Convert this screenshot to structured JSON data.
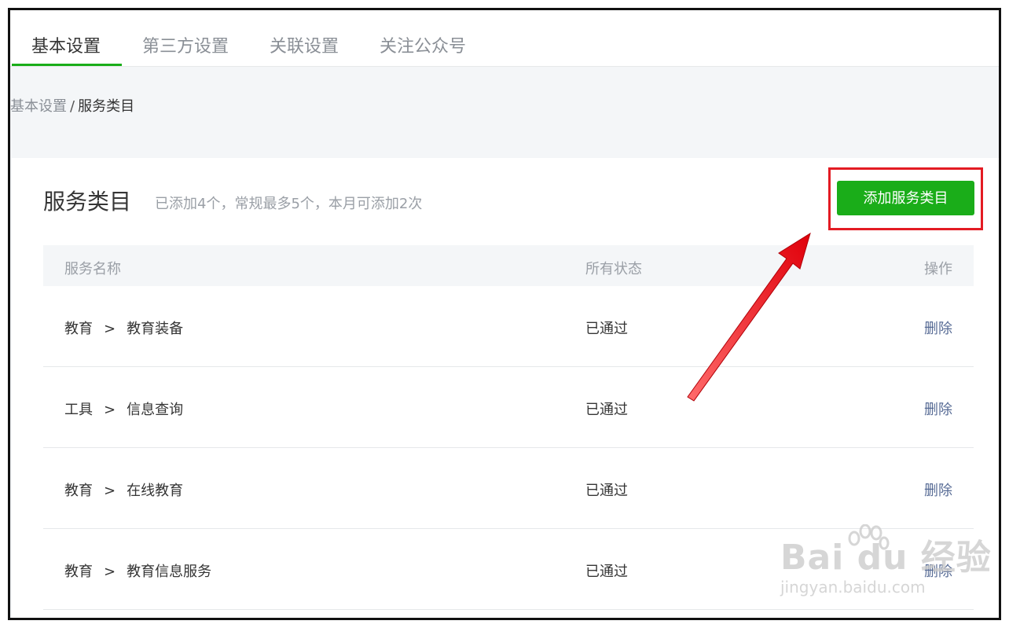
{
  "tabs": [
    {
      "label": "基本设置",
      "active": true
    },
    {
      "label": "第三方设置",
      "active": false
    },
    {
      "label": "关联设置",
      "active": false
    },
    {
      "label": "关注公众号",
      "active": false
    }
  ],
  "breadcrumb": {
    "parent": "基本设置",
    "separator": "/",
    "current": "服务类目"
  },
  "card": {
    "title": "服务类目",
    "description": "已添加4个，常规最多5个，本月可添加2次",
    "add_button": "添加服务类目"
  },
  "table": {
    "headers": {
      "name": "服务名称",
      "status": "所有状态",
      "ops": "操作"
    },
    "rows": [
      {
        "category": "教育",
        "sub": "教育装备",
        "status": "已通过",
        "action": "删除"
      },
      {
        "category": "工具",
        "sub": "信息查询",
        "status": "已通过",
        "action": "删除"
      },
      {
        "category": "教育",
        "sub": "在线教育",
        "status": "已通过",
        "action": "删除"
      },
      {
        "category": "教育",
        "sub": "教育信息服务",
        "status": "已通过",
        "action": "删除"
      }
    ],
    "chevron": ">"
  },
  "watermark": {
    "brand": "Bai du 经验",
    "url": "jingyan.baidu.com"
  },
  "colors": {
    "accent": "#1aad19",
    "highlight": "#e31b23",
    "link": "#576b95"
  }
}
